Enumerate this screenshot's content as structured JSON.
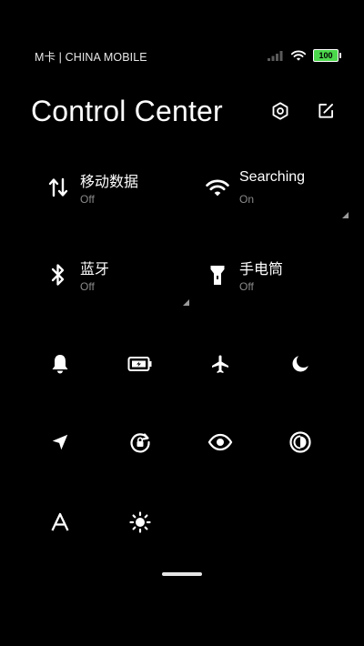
{
  "status_bar": {
    "carrier": "M卡 | CHINA MOBILE",
    "battery_level": "100",
    "battery_color": "#4cd84c",
    "signal_icon": "cellular-signal-icon",
    "wifi_icon": "wifi-icon"
  },
  "header": {
    "title": "Control Center",
    "settings_icon": "settings-icon",
    "edit_icon": "edit-icon"
  },
  "tiles": [
    {
      "name": "移动数据",
      "state": "Off",
      "icon": "mobile-data-icon",
      "expandable": false
    },
    {
      "name": "Searching",
      "state": "On",
      "icon": "wifi-icon",
      "expandable": true
    },
    {
      "name": "蓝牙",
      "state": "Off",
      "icon": "bluetooth-icon",
      "expandable": true
    },
    {
      "name": "手电筒",
      "state": "Off",
      "icon": "flashlight-icon",
      "expandable": false
    }
  ],
  "quick_toggles": [
    {
      "icon": "bell-icon"
    },
    {
      "icon": "battery-saver-icon"
    },
    {
      "icon": "airplane-icon"
    },
    {
      "icon": "moon-icon"
    },
    {
      "icon": "location-icon"
    },
    {
      "icon": "rotation-lock-icon"
    },
    {
      "icon": "eye-icon"
    },
    {
      "icon": "contrast-icon"
    },
    {
      "icon": "font-size-icon"
    },
    {
      "icon": "brightness-icon"
    }
  ],
  "colors": {
    "background": "#000000",
    "text": "#ffffff",
    "secondary_text": "#8a8a8a"
  }
}
